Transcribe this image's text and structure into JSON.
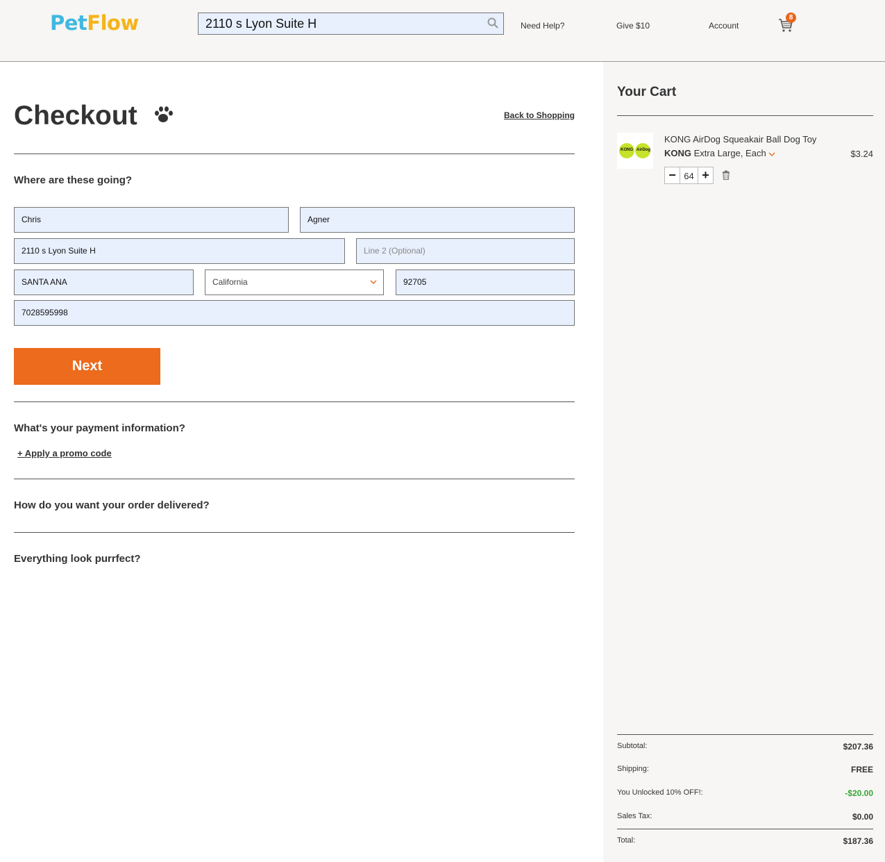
{
  "header": {
    "logo_pet": "Pet",
    "logo_flow": "Flow",
    "search_value": "2110 s Lyon Suite H",
    "nav_help": "Need Help?",
    "nav_give": "Give $10",
    "nav_account": "Account",
    "cart_count": "8"
  },
  "main": {
    "title": "Checkout",
    "back_link": "Back to Shopping",
    "shipping_heading": "Where are these going?",
    "fields": {
      "first_name": "Chris",
      "last_name": "Agner",
      "address1": "2110 s Lyon Suite H",
      "address2_placeholder": "Line 2 (Optional)",
      "city": "SANTA ANA",
      "state": "California",
      "zip": "92705",
      "phone": "7028595998"
    },
    "next_label": "Next",
    "payment_heading": "What's your payment information?",
    "promo_link": "+ Apply a promo code",
    "delivery_heading": "How do you want your order delivered?",
    "review_heading": "Everything look purrfect?"
  },
  "cart": {
    "title": "Your Cart",
    "item": {
      "name": "KONG AirDog Squeakair Ball Dog Toy",
      "brand": "KONG",
      "variant": "Extra Large, Each",
      "price": "$3.24",
      "quantity": "64",
      "thumb_text_left": "KONG",
      "thumb_text_right": "AirDog"
    },
    "summary": {
      "subtotal_label": "Subtotal:",
      "subtotal_value": "$207.36",
      "shipping_label": "Shipping:",
      "shipping_value": "FREE",
      "discount_label": "You Unlocked 10% OFF!:",
      "discount_value": "-$20.00",
      "tax_label": "Sales Tax:",
      "tax_value": "$0.00",
      "total_label": "Total:",
      "total_value": "$187.36"
    }
  },
  "colors": {
    "accent_orange": "#ec6b1c",
    "logo_blue": "#3fb8e0",
    "logo_yellow": "#f4b41a",
    "discount_green": "#3aa537",
    "field_bg": "#e8f0fe"
  },
  "icons": [
    "search-icon",
    "cart-icon",
    "paw-icon",
    "chevron-down-icon",
    "trash-icon",
    "minus-icon",
    "plus-icon"
  ]
}
